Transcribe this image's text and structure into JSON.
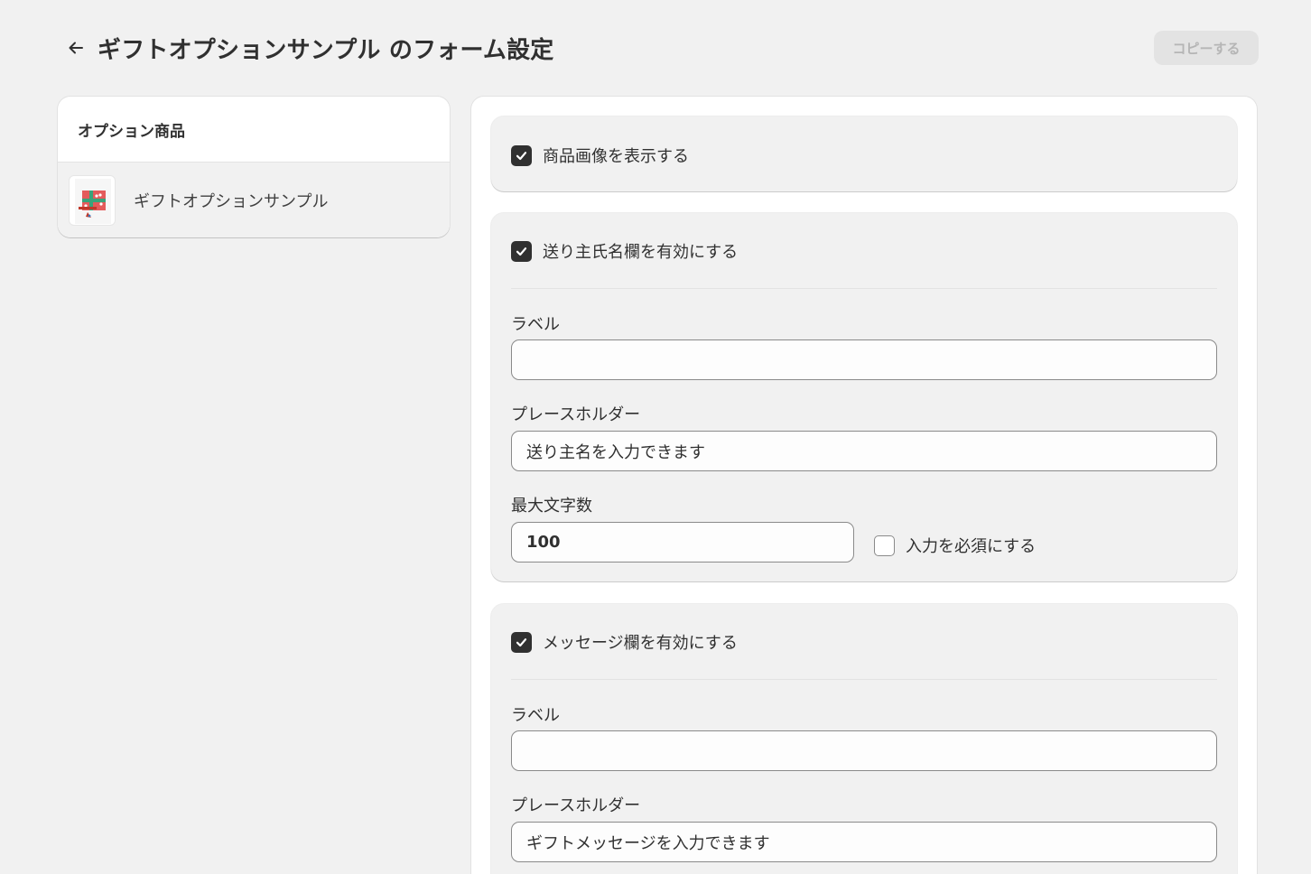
{
  "header": {
    "title": "ギフトオプションサンプル のフォーム設定",
    "copy_button": "コピーする"
  },
  "sidebar": {
    "title": "オプション商品",
    "product": {
      "name": "ギフトオプションサンプル"
    }
  },
  "sections": {
    "show_image": {
      "label": "商品画像を表示する",
      "checked": true
    },
    "sender": {
      "toggle_label": "送り主氏名欄を有効にする",
      "checked": true,
      "label_field": {
        "label": "ラベル",
        "value": ""
      },
      "placeholder_field": {
        "label": "プレースホルダー",
        "value": "送り主名を入力できます"
      },
      "max_chars": {
        "label": "最大文字数",
        "value": "100"
      },
      "required": {
        "label": "入力を必須にする",
        "checked": false
      }
    },
    "message": {
      "toggle_label": "メッセージ欄を有効にする",
      "checked": true,
      "label_field": {
        "label": "ラベル",
        "value": ""
      },
      "placeholder_field": {
        "label": "プレースホルダー",
        "value": "ギフトメッセージを入力できます"
      }
    }
  },
  "colors": {
    "background": "#f1f1f1",
    "card": "#ffffff",
    "checkbox_on": "#303030",
    "text": "#303030",
    "disabled_button_bg": "#e3e3e3",
    "disabled_button_text": "#b5b5b5"
  }
}
